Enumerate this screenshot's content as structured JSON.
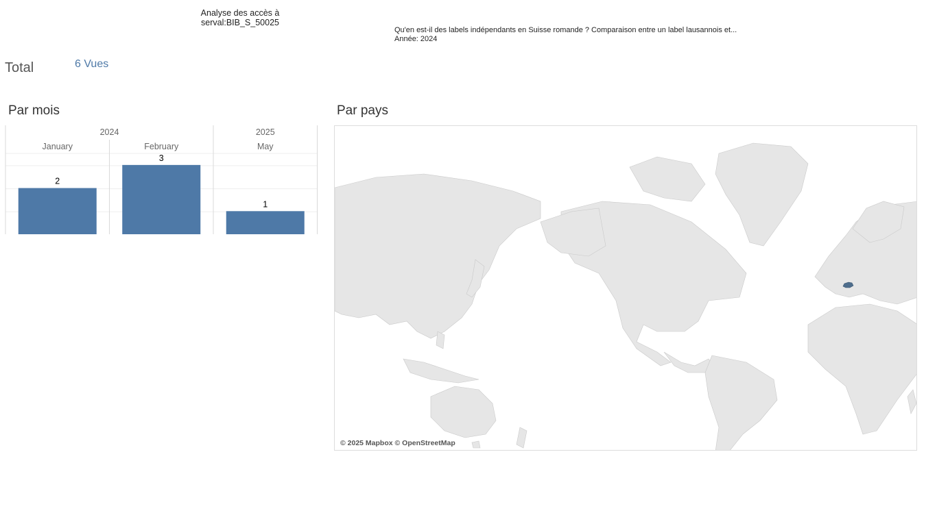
{
  "header": {
    "title_line1": "Analyse des accès à",
    "title_line2": "serval:BIB_S_50025"
  },
  "document": {
    "title": "Qu'en est-il des labels indépendants en Suisse romande ? Comparaison entre un label lausannois et...",
    "year_line": "Année: 2024"
  },
  "total": {
    "label": "Total",
    "value": "6 Vues"
  },
  "sections": {
    "by_month": "Par mois",
    "by_country": "Par pays"
  },
  "chart_data": {
    "type": "bar",
    "title": "Par mois",
    "years": [
      {
        "label": "2024",
        "months": [
          "January",
          "February"
        ]
      },
      {
        "label": "2025",
        "months": [
          "May"
        ]
      }
    ],
    "categories": [
      "January",
      "February",
      "May"
    ],
    "values": [
      2,
      3,
      1
    ],
    "ylim": [
      0,
      3.5
    ],
    "bar_color": "#4e79a7",
    "data_labels": true,
    "grid": true
  },
  "map": {
    "highlighted_country": "Switzerland",
    "highlight_color": "#4e6d8c",
    "land_color": "#e6e6e6",
    "attribution": "© 2025 Mapbox © OpenStreetMap"
  }
}
